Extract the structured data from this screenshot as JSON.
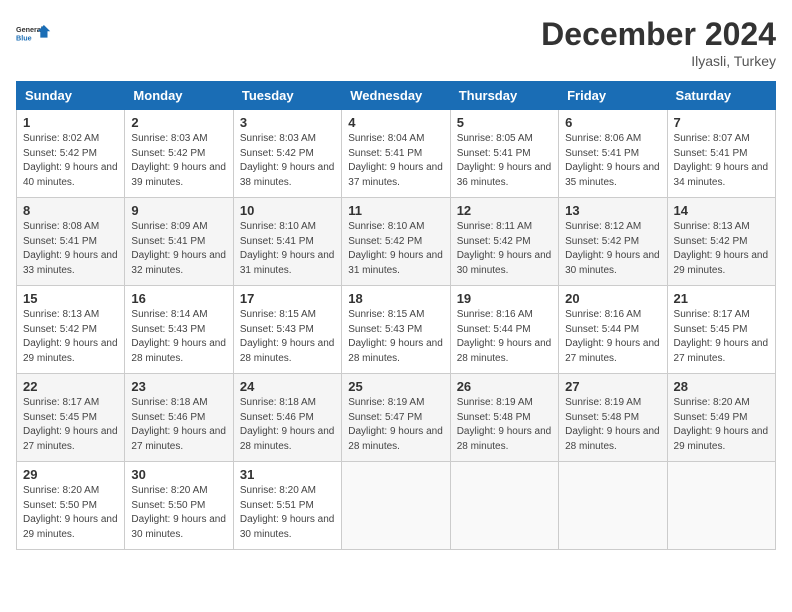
{
  "header": {
    "logo_line1": "General",
    "logo_line2": "Blue",
    "month_title": "December 2024",
    "location": "Ilyasli, Turkey"
  },
  "columns": [
    "Sunday",
    "Monday",
    "Tuesday",
    "Wednesday",
    "Thursday",
    "Friday",
    "Saturday"
  ],
  "weeks": [
    [
      {
        "day": "1",
        "sunrise": "Sunrise: 8:02 AM",
        "sunset": "Sunset: 5:42 PM",
        "daylight": "Daylight: 9 hours and 40 minutes."
      },
      {
        "day": "2",
        "sunrise": "Sunrise: 8:03 AM",
        "sunset": "Sunset: 5:42 PM",
        "daylight": "Daylight: 9 hours and 39 minutes."
      },
      {
        "day": "3",
        "sunrise": "Sunrise: 8:03 AM",
        "sunset": "Sunset: 5:42 PM",
        "daylight": "Daylight: 9 hours and 38 minutes."
      },
      {
        "day": "4",
        "sunrise": "Sunrise: 8:04 AM",
        "sunset": "Sunset: 5:41 PM",
        "daylight": "Daylight: 9 hours and 37 minutes."
      },
      {
        "day": "5",
        "sunrise": "Sunrise: 8:05 AM",
        "sunset": "Sunset: 5:41 PM",
        "daylight": "Daylight: 9 hours and 36 minutes."
      },
      {
        "day": "6",
        "sunrise": "Sunrise: 8:06 AM",
        "sunset": "Sunset: 5:41 PM",
        "daylight": "Daylight: 9 hours and 35 minutes."
      },
      {
        "day": "7",
        "sunrise": "Sunrise: 8:07 AM",
        "sunset": "Sunset: 5:41 PM",
        "daylight": "Daylight: 9 hours and 34 minutes."
      }
    ],
    [
      {
        "day": "8",
        "sunrise": "Sunrise: 8:08 AM",
        "sunset": "Sunset: 5:41 PM",
        "daylight": "Daylight: 9 hours and 33 minutes."
      },
      {
        "day": "9",
        "sunrise": "Sunrise: 8:09 AM",
        "sunset": "Sunset: 5:41 PM",
        "daylight": "Daylight: 9 hours and 32 minutes."
      },
      {
        "day": "10",
        "sunrise": "Sunrise: 8:10 AM",
        "sunset": "Sunset: 5:41 PM",
        "daylight": "Daylight: 9 hours and 31 minutes."
      },
      {
        "day": "11",
        "sunrise": "Sunrise: 8:10 AM",
        "sunset": "Sunset: 5:42 PM",
        "daylight": "Daylight: 9 hours and 31 minutes."
      },
      {
        "day": "12",
        "sunrise": "Sunrise: 8:11 AM",
        "sunset": "Sunset: 5:42 PM",
        "daylight": "Daylight: 9 hours and 30 minutes."
      },
      {
        "day": "13",
        "sunrise": "Sunrise: 8:12 AM",
        "sunset": "Sunset: 5:42 PM",
        "daylight": "Daylight: 9 hours and 30 minutes."
      },
      {
        "day": "14",
        "sunrise": "Sunrise: 8:13 AM",
        "sunset": "Sunset: 5:42 PM",
        "daylight": "Daylight: 9 hours and 29 minutes."
      }
    ],
    [
      {
        "day": "15",
        "sunrise": "Sunrise: 8:13 AM",
        "sunset": "Sunset: 5:42 PM",
        "daylight": "Daylight: 9 hours and 29 minutes."
      },
      {
        "day": "16",
        "sunrise": "Sunrise: 8:14 AM",
        "sunset": "Sunset: 5:43 PM",
        "daylight": "Daylight: 9 hours and 28 minutes."
      },
      {
        "day": "17",
        "sunrise": "Sunrise: 8:15 AM",
        "sunset": "Sunset: 5:43 PM",
        "daylight": "Daylight: 9 hours and 28 minutes."
      },
      {
        "day": "18",
        "sunrise": "Sunrise: 8:15 AM",
        "sunset": "Sunset: 5:43 PM",
        "daylight": "Daylight: 9 hours and 28 minutes."
      },
      {
        "day": "19",
        "sunrise": "Sunrise: 8:16 AM",
        "sunset": "Sunset: 5:44 PM",
        "daylight": "Daylight: 9 hours and 28 minutes."
      },
      {
        "day": "20",
        "sunrise": "Sunrise: 8:16 AM",
        "sunset": "Sunset: 5:44 PM",
        "daylight": "Daylight: 9 hours and 27 minutes."
      },
      {
        "day": "21",
        "sunrise": "Sunrise: 8:17 AM",
        "sunset": "Sunset: 5:45 PM",
        "daylight": "Daylight: 9 hours and 27 minutes."
      }
    ],
    [
      {
        "day": "22",
        "sunrise": "Sunrise: 8:17 AM",
        "sunset": "Sunset: 5:45 PM",
        "daylight": "Daylight: 9 hours and 27 minutes."
      },
      {
        "day": "23",
        "sunrise": "Sunrise: 8:18 AM",
        "sunset": "Sunset: 5:46 PM",
        "daylight": "Daylight: 9 hours and 27 minutes."
      },
      {
        "day": "24",
        "sunrise": "Sunrise: 8:18 AM",
        "sunset": "Sunset: 5:46 PM",
        "daylight": "Daylight: 9 hours and 28 minutes."
      },
      {
        "day": "25",
        "sunrise": "Sunrise: 8:19 AM",
        "sunset": "Sunset: 5:47 PM",
        "daylight": "Daylight: 9 hours and 28 minutes."
      },
      {
        "day": "26",
        "sunrise": "Sunrise: 8:19 AM",
        "sunset": "Sunset: 5:48 PM",
        "daylight": "Daylight: 9 hours and 28 minutes."
      },
      {
        "day": "27",
        "sunrise": "Sunrise: 8:19 AM",
        "sunset": "Sunset: 5:48 PM",
        "daylight": "Daylight: 9 hours and 28 minutes."
      },
      {
        "day": "28",
        "sunrise": "Sunrise: 8:20 AM",
        "sunset": "Sunset: 5:49 PM",
        "daylight": "Daylight: 9 hours and 29 minutes."
      }
    ],
    [
      {
        "day": "29",
        "sunrise": "Sunrise: 8:20 AM",
        "sunset": "Sunset: 5:50 PM",
        "daylight": "Daylight: 9 hours and 29 minutes."
      },
      {
        "day": "30",
        "sunrise": "Sunrise: 8:20 AM",
        "sunset": "Sunset: 5:50 PM",
        "daylight": "Daylight: 9 hours and 30 minutes."
      },
      {
        "day": "31",
        "sunrise": "Sunrise: 8:20 AM",
        "sunset": "Sunset: 5:51 PM",
        "daylight": "Daylight: 9 hours and 30 minutes."
      },
      null,
      null,
      null,
      null
    ]
  ]
}
